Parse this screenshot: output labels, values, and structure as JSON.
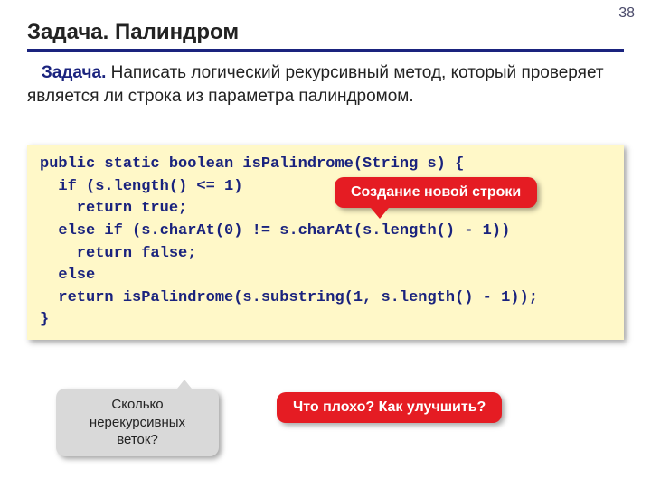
{
  "pageNumber": "38",
  "title": "Задача. Палиндром",
  "problem": {
    "lead": "Задача.",
    "text": " Написать логический рекурсивный метод, который проверяет является ли строка из параметра палиндромом."
  },
  "code": "public static boolean isPalindrome(String s) {\n  if (s.length() <= 1)\n    return true;\n  else if (s.charAt(0) != s.charAt(s.length() - 1))\n    return false;\n  else\n  return isPalindrome(s.substring(1, s.length() - 1));\n}",
  "callouts": {
    "newString": "Создание новой строки",
    "branches": "Сколько нерекурсивных веток?",
    "improve": "Что плохо? Как улучшить?"
  }
}
